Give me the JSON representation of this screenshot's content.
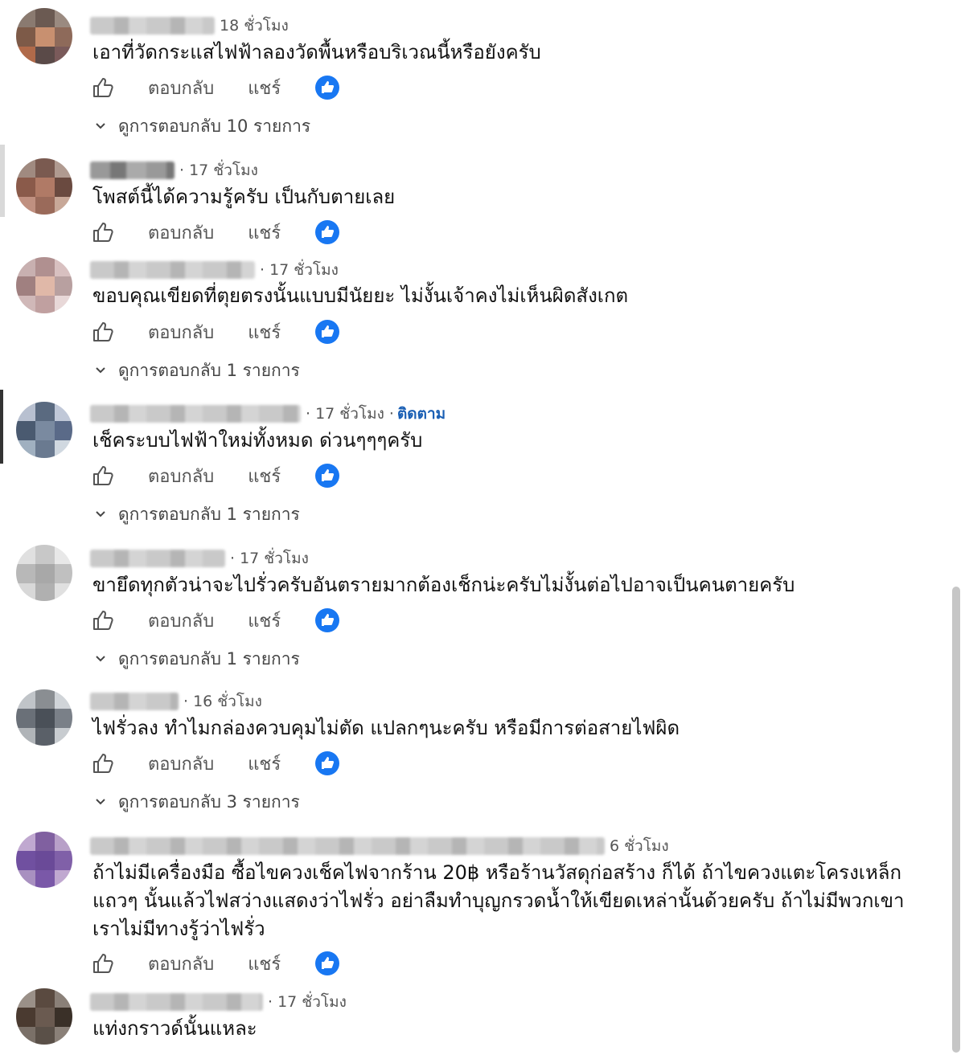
{
  "labels": {
    "reply": "ตอบกลับ",
    "share": "แชร์",
    "follow": "ติดตาม"
  },
  "colors": {
    "like_blue": "#1877f2",
    "follow_blue": "#1a5fb4"
  },
  "comments": [
    {
      "time": "18 ชั่วโมง",
      "text": "เอาที่วัดกระแสไฟฟ้าลองวัดพื้นหรือบริเวณนี้หรือยังครับ",
      "replies": "ดูการตอบกลับ 10 รายการ"
    },
    {
      "time": "· 17 ชั่วโมง",
      "text": "โพสต์นี้ได้ความรู้ครับ เป็นกับตายเลย",
      "replies": ""
    },
    {
      "time": "· 17 ชั่วโมง",
      "text": "ขอบคุณเขียดที่ตุยตรงนั้นแบบมีนัยยะ ไม่งั้นเจ้าคงไม่เห็นผิดสังเกต",
      "replies": "ดูการตอบกลับ 1 รายการ"
    },
    {
      "time": "· 17 ชั่วโมง ·",
      "text": "เช็คระบบไฟฟ้าใหม่ทั้งหมด ด่วนๆๆๆครับ",
      "replies": "ดูการตอบกลับ 1 รายการ",
      "follow": true
    },
    {
      "time": "· 17 ชั่วโมง",
      "text": "ขายึดทุกตัวน่าจะไปรั่วครับอันตรายมากต้องเช็กน่ะครับไม่งั้นต่อไปอาจเป็นคนตายครับ",
      "replies": "ดูการตอบกลับ 1 รายการ"
    },
    {
      "time": "· 16 ชั่วโมง",
      "text": "ไฟรั่วลง ทำไมกล่องควบคุมไม่ตัด แปลกๆนะครับ หรือมีการต่อสายไฟผิด",
      "replies": "ดูการตอบกลับ 3 รายการ"
    },
    {
      "time": "6 ชั่วโมง",
      "text": "ถ้าไม่มีเครื่องมือ ซื้อไขควงเช็คไฟจากร้าน 20฿ หรือร้านวัสดุก่อสร้าง ก็ได้ ถ้าไขควงแตะโครงเหล็ก\nแถวๆ นั้นแล้วไฟสว่างแสดงว่าไฟรั่ว อย่าลืมทำบุญกรวดน้ำให้เขียดเหล่านั้นด้วยครับ ถ้าไม่มีพวกเขา\nเราไม่มีทางรู้ว่าไฟรั่ว",
      "replies": ""
    },
    {
      "time": "· 17 ชั่วโมง",
      "text": "แท่งกราวด์นั้นแหละ",
      "replies": ""
    }
  ]
}
